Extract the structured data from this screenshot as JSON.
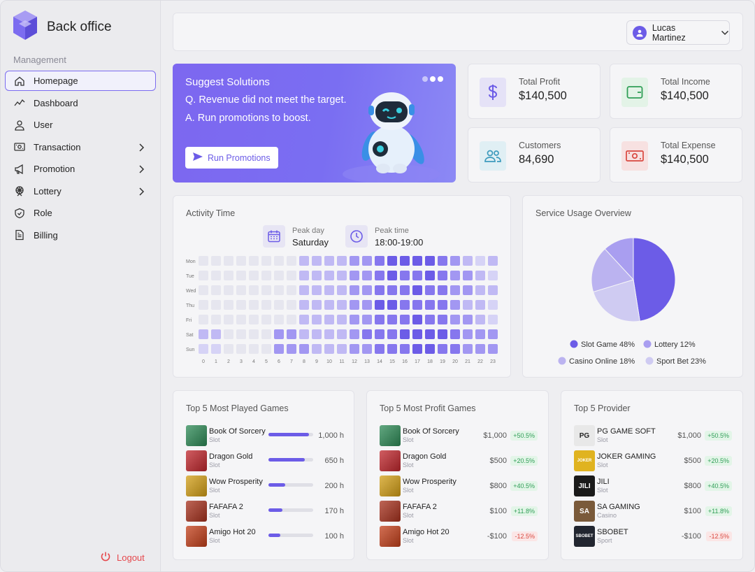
{
  "app": {
    "title": "Back office"
  },
  "sidebar": {
    "section": "Management",
    "items": [
      {
        "label": "Homepage",
        "icon": "home-icon",
        "active": true,
        "chevron": false
      },
      {
        "label": "Dashboard",
        "icon": "trend-icon",
        "active": false,
        "chevron": false
      },
      {
        "label": "User",
        "icon": "user-icon",
        "active": false,
        "chevron": false
      },
      {
        "label": "Transaction",
        "icon": "transaction-icon",
        "active": false,
        "chevron": true
      },
      {
        "label": "Promotion",
        "icon": "megaphone-icon",
        "active": false,
        "chevron": true
      },
      {
        "label": "Lottery",
        "icon": "ferris-wheel-icon",
        "active": false,
        "chevron": true
      },
      {
        "label": "Role",
        "icon": "shield-icon",
        "active": false,
        "chevron": false
      },
      {
        "label": "Billing",
        "icon": "document-icon",
        "active": false,
        "chevron": false
      }
    ],
    "logout": "Logout"
  },
  "header": {
    "user_name": "Lucas Martinez"
  },
  "promo": {
    "title": "Suggest Solutions",
    "question": "Q. Revenue did not meet the target.",
    "answer": "A. Run promotions to boost.",
    "button": "Run Promotions"
  },
  "stats": {
    "total_profit": {
      "label": "Total Profit",
      "value": "$140,500"
    },
    "total_income": {
      "label": "Total Income",
      "value": "$140,500"
    },
    "customers": {
      "label": "Customers",
      "value": "84,690"
    },
    "total_expense": {
      "label": "Total Expense",
      "value": "$140,500"
    }
  },
  "activity": {
    "title": "Activity Time",
    "peak_day_label": "Peak day",
    "peak_day": "Saturday",
    "peak_time_label": "Peak time",
    "peak_time": "18:00-19:00"
  },
  "service": {
    "title": "Service Usage Overview"
  },
  "colors": {
    "accent": "#6c5ce7",
    "heat": [
      "#e6e6ef",
      "#d6d3f6",
      "#c0b9f4",
      "#a297f2",
      "#8677ee",
      "#6c5ce7"
    ],
    "pie": [
      "#6c5ce7",
      "#cfcbf2",
      "#bbb3f0",
      "#a99ef0"
    ]
  },
  "chart_data": [
    {
      "type": "heatmap",
      "title": "Activity Time",
      "rows": [
        "Mon",
        "Tue",
        "Wed",
        "Thu",
        "Fri",
        "Sat",
        "Sun"
      ],
      "columns": [
        "0",
        "1",
        "2",
        "3",
        "4",
        "5",
        "6",
        "7",
        "8",
        "9",
        "10",
        "11",
        "12",
        "13",
        "14",
        "15",
        "16",
        "17",
        "18",
        "19",
        "20",
        "21",
        "22",
        "23"
      ],
      "values": [
        [
          0,
          0,
          0,
          0,
          0,
          0,
          0,
          0,
          2,
          2,
          2,
          2,
          3,
          3,
          4,
          5,
          5,
          5,
          5,
          4,
          3,
          2,
          1,
          2
        ],
        [
          0,
          0,
          0,
          0,
          0,
          0,
          0,
          0,
          2,
          2,
          2,
          2,
          3,
          3,
          4,
          5,
          4,
          4,
          5,
          4,
          3,
          3,
          2,
          1
        ],
        [
          0,
          0,
          0,
          0,
          0,
          0,
          0,
          0,
          2,
          2,
          2,
          2,
          3,
          3,
          4,
          4,
          4,
          5,
          4,
          4,
          3,
          3,
          2,
          2
        ],
        [
          0,
          0,
          0,
          0,
          0,
          0,
          0,
          0,
          2,
          2,
          2,
          2,
          3,
          3,
          5,
          5,
          4,
          4,
          4,
          4,
          3,
          2,
          2,
          1
        ],
        [
          0,
          0,
          0,
          0,
          0,
          0,
          0,
          0,
          2,
          2,
          2,
          2,
          3,
          3,
          4,
          4,
          4,
          5,
          4,
          4,
          3,
          3,
          2,
          1
        ],
        [
          2,
          2,
          0,
          0,
          0,
          0,
          3,
          3,
          2,
          2,
          2,
          2,
          3,
          4,
          4,
          4,
          5,
          5,
          5,
          5,
          4,
          3,
          3,
          3
        ],
        [
          1,
          1,
          0,
          0,
          0,
          0,
          3,
          3,
          3,
          2,
          2,
          2,
          3,
          3,
          4,
          4,
          4,
          5,
          5,
          4,
          4,
          3,
          3,
          3
        ]
      ]
    },
    {
      "type": "pie",
      "title": "Service Usage Overview",
      "labels": [
        "Slot Game",
        "Sport Bet",
        "Casino Online",
        "Lottery"
      ],
      "values": [
        48,
        23,
        18,
        12
      ],
      "legend": [
        "Slot Game 48%",
        "Lottery 12%",
        "Casino Online 18%",
        "Sport Bet 23%"
      ]
    }
  ],
  "top_played": {
    "title": "Top 5 Most Played Games",
    "rows": [
      {
        "name": "Book Of Sorcery",
        "sub": "Slot",
        "value": "1,000 h",
        "fraction": 0.9,
        "thumb": "#2e8b57"
      },
      {
        "name": "Dragon Gold",
        "sub": "Slot",
        "value": "650 h",
        "fraction": 0.82,
        "thumb": "#c1272d"
      },
      {
        "name": "Wow Prosperity",
        "sub": "Slot",
        "value": "200 h",
        "fraction": 0.38,
        "thumb": "#d4a017"
      },
      {
        "name": "FAFAFA 2",
        "sub": "Slot",
        "value": "170 h",
        "fraction": 0.32,
        "thumb": "#a8321e"
      },
      {
        "name": "Amigo Hot 20",
        "sub": "Slot",
        "value": "100 h",
        "fraction": 0.27,
        "thumb": "#c4401b"
      }
    ]
  },
  "top_profit": {
    "title": "Top 5 Most Profit Games",
    "rows": [
      {
        "name": "Book Of Sorcery",
        "sub": "Slot",
        "value": "$1,000",
        "change": "+50.5%",
        "up": true,
        "thumb": "#2e8b57"
      },
      {
        "name": "Dragon Gold",
        "sub": "Slot",
        "value": "$500",
        "change": "+20.5%",
        "up": true,
        "thumb": "#c1272d"
      },
      {
        "name": "Wow Prosperity",
        "sub": "Slot",
        "value": "$800",
        "change": "+40.5%",
        "up": true,
        "thumb": "#d4a017"
      },
      {
        "name": "FAFAFA 2",
        "sub": "Slot",
        "value": "$100",
        "change": "+11.8%",
        "up": true,
        "thumb": "#a8321e"
      },
      {
        "name": "Amigo Hot 20",
        "sub": "Slot",
        "value": "-$100",
        "change": "-12.5%",
        "up": false,
        "thumb": "#c4401b"
      }
    ]
  },
  "top_provider": {
    "title": "Top 5 Provider",
    "rows": [
      {
        "name": "PG GAME SOFT",
        "sub": "Slot",
        "value": "$1,000",
        "change": "+50.5%",
        "up": true,
        "thumb": "#e8e8e8",
        "logo": "PG"
      },
      {
        "name": "JOKER GAMING",
        "sub": "Slot",
        "value": "$500",
        "change": "+20.5%",
        "up": true,
        "thumb": "#e0b320",
        "logo": "JOKER"
      },
      {
        "name": "JILI",
        "sub": "Slot",
        "value": "$800",
        "change": "+40.5%",
        "up": true,
        "thumb": "#1a1a1a",
        "logo": "JILI"
      },
      {
        "name": "SA GAMING",
        "sub": "Casino",
        "value": "$100",
        "change": "+11.8%",
        "up": true,
        "thumb": "#7a5a3a",
        "logo": "SA"
      },
      {
        "name": "SBOBET",
        "sub": "Sport",
        "value": "-$100",
        "change": "-12.5%",
        "up": false,
        "thumb": "#222630",
        "logo": "SBOBET"
      }
    ]
  }
}
